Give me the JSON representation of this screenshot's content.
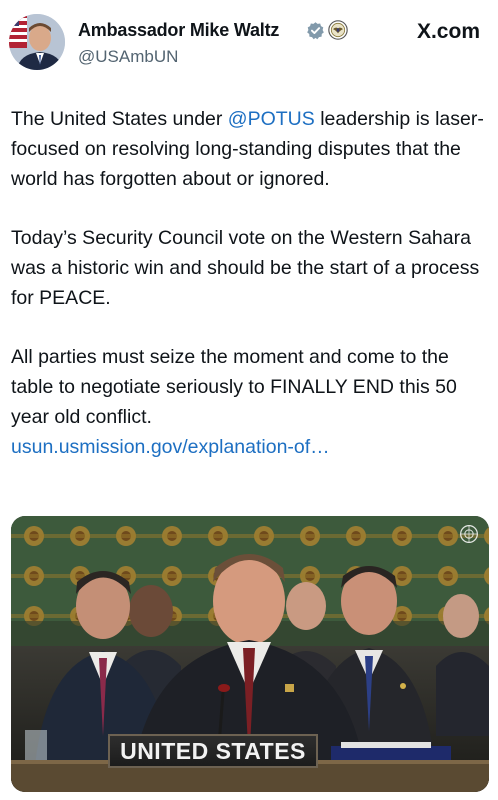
{
  "header": {
    "display_name": "Ambassador Mike Waltz",
    "handle": "@USAmbUN",
    "site_logo": "X.com",
    "icons": [
      "verified-badge-icon",
      "government-seal-icon"
    ],
    "badge_color": "#829aab"
  },
  "tweet": {
    "p1_before": "The United States under ",
    "p1_mention": "@POTUS",
    "p1_after": " leadership is laser-focused on resolving long-standing disputes that the world has forgotten about or ignored.",
    "p2": "Today’s Security Council vote on the Western Sahara was a historic win and should be the start of a process for PEACE.",
    "p3": "All parties must seize the moment and come to the table to negotiate seriously to FINALLY END this 50 year old conflict.",
    "link": "usun.usmission.gov/explanation-of…",
    "link_color": "#1d6fc2"
  },
  "media": {
    "nameplate": "UNITED STATES",
    "watermark_icon": "un-emblem-icon"
  }
}
